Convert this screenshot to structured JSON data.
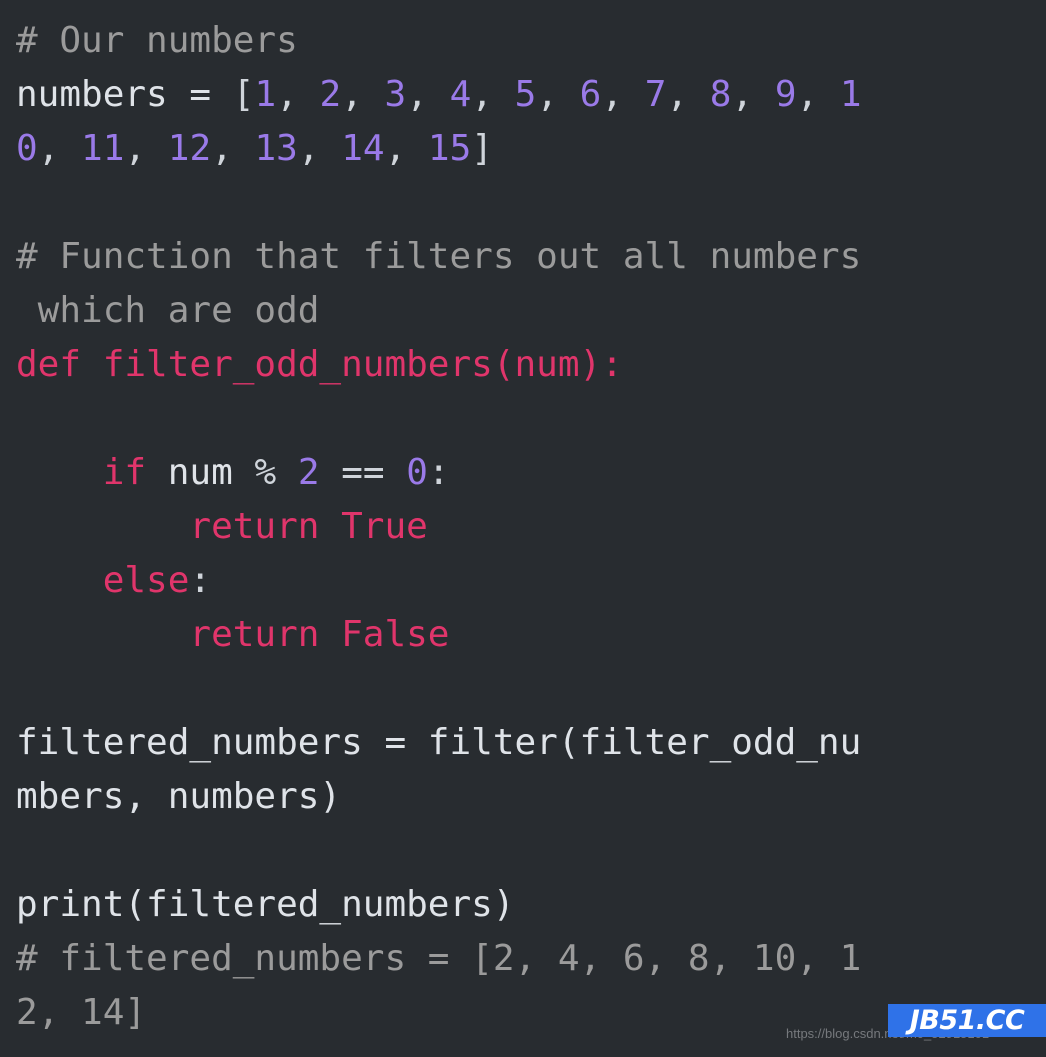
{
  "editor": {
    "language": "python",
    "background_color": "#282c30",
    "theme_colors": {
      "comment": "#9b9b9b",
      "plain": "#dfe3e8",
      "keyword": "#e0356b",
      "number": "#9a7ae8",
      "punct": "#cfd4da",
      "badge_blue": "#2f72e8"
    },
    "full_text": "# Our numbers\nnumbers = [1, 2, 3, 4, 5, 6, 7, 8, 9, 10, 11, 12, 13, 14, 15]\n\n# Function that filters out all numbers which are odd\ndef filter_odd_numbers(num):\n\n    if num % 2 == 0:\n        return True\n    else:\n        return False\n\nfiltered_numbers = filter(filter_odd_numbers, numbers)\n\nprint(filtered_numbers)\n# filtered_numbers = [2, 4, 6, 8, 10, 12, 14]",
    "lines": [
      {
        "id": "line-comment-our-numbers",
        "tokens": [
          {
            "t": "# Our numbers",
            "c": "comment"
          }
        ]
      },
      {
        "id": "line-numbers-assign-part1",
        "tokens": [
          {
            "t": "numbers = ",
            "c": "plain"
          },
          {
            "t": "[",
            "c": "punct"
          },
          {
            "t": "1",
            "c": "number"
          },
          {
            "t": ", ",
            "c": "punct"
          },
          {
            "t": "2",
            "c": "number"
          },
          {
            "t": ", ",
            "c": "punct"
          },
          {
            "t": "3",
            "c": "number"
          },
          {
            "t": ", ",
            "c": "punct"
          },
          {
            "t": "4",
            "c": "number"
          },
          {
            "t": ", ",
            "c": "punct"
          },
          {
            "t": "5",
            "c": "number"
          },
          {
            "t": ", ",
            "c": "punct"
          },
          {
            "t": "6",
            "c": "number"
          },
          {
            "t": ", ",
            "c": "punct"
          },
          {
            "t": "7",
            "c": "number"
          },
          {
            "t": ", ",
            "c": "punct"
          },
          {
            "t": "8",
            "c": "number"
          },
          {
            "t": ", ",
            "c": "punct"
          },
          {
            "t": "9",
            "c": "number"
          },
          {
            "t": ", ",
            "c": "punct"
          },
          {
            "t": "1",
            "c": "number"
          }
        ]
      },
      {
        "id": "line-numbers-assign-part2",
        "tokens": [
          {
            "t": "0",
            "c": "number"
          },
          {
            "t": ", ",
            "c": "punct"
          },
          {
            "t": "11",
            "c": "number"
          },
          {
            "t": ", ",
            "c": "punct"
          },
          {
            "t": "12",
            "c": "number"
          },
          {
            "t": ", ",
            "c": "punct"
          },
          {
            "t": "13",
            "c": "number"
          },
          {
            "t": ", ",
            "c": "punct"
          },
          {
            "t": "14",
            "c": "number"
          },
          {
            "t": ", ",
            "c": "punct"
          },
          {
            "t": "15",
            "c": "number"
          },
          {
            "t": "]",
            "c": "punct"
          }
        ]
      },
      {
        "id": "line-blank-1",
        "tokens": []
      },
      {
        "id": "line-comment-function-part1",
        "tokens": [
          {
            "t": "# Function that filters out all numbers",
            "c": "comment"
          }
        ]
      },
      {
        "id": "line-comment-function-part2",
        "tokens": [
          {
            "t": " which are odd",
            "c": "comment"
          }
        ]
      },
      {
        "id": "line-def-filter-odd-numbers",
        "tokens": [
          {
            "t": "def filter_odd_numbers(num):",
            "c": "func"
          }
        ]
      },
      {
        "id": "line-blank-2",
        "tokens": []
      },
      {
        "id": "line-if-num-mod",
        "tokens": [
          {
            "t": "    ",
            "c": "plain"
          },
          {
            "t": "if",
            "c": "keyword"
          },
          {
            "t": " num ",
            "c": "plain"
          },
          {
            "t": "%",
            "c": "punct"
          },
          {
            "t": " ",
            "c": "plain"
          },
          {
            "t": "2",
            "c": "number"
          },
          {
            "t": " ",
            "c": "plain"
          },
          {
            "t": "==",
            "c": "punct"
          },
          {
            "t": " ",
            "c": "plain"
          },
          {
            "t": "0",
            "c": "number"
          },
          {
            "t": ":",
            "c": "punct"
          }
        ]
      },
      {
        "id": "line-return-true",
        "tokens": [
          {
            "t": "        ",
            "c": "plain"
          },
          {
            "t": "return True",
            "c": "keyword"
          }
        ]
      },
      {
        "id": "line-else",
        "tokens": [
          {
            "t": "    ",
            "c": "plain"
          },
          {
            "t": "else",
            "c": "keyword"
          },
          {
            "t": ":",
            "c": "punct"
          }
        ]
      },
      {
        "id": "line-return-false",
        "tokens": [
          {
            "t": "        ",
            "c": "plain"
          },
          {
            "t": "return False",
            "c": "keyword"
          }
        ]
      },
      {
        "id": "line-blank-3",
        "tokens": []
      },
      {
        "id": "line-filtered-assign-part1",
        "tokens": [
          {
            "t": "filtered_numbers = filter(filter_odd_nu",
            "c": "plain"
          }
        ]
      },
      {
        "id": "line-filtered-assign-part2",
        "tokens": [
          {
            "t": "mbers, numbers)",
            "c": "plain"
          }
        ]
      },
      {
        "id": "line-blank-4",
        "tokens": []
      },
      {
        "id": "line-print-filtered",
        "tokens": [
          {
            "t": "print(filtered_numbers)",
            "c": "plain"
          }
        ]
      },
      {
        "id": "line-comment-result-part1",
        "tokens": [
          {
            "t": "# filtered_numbers = [2, 4, 6, 8, 10, 1",
            "c": "comment"
          }
        ]
      },
      {
        "id": "line-comment-result-part2",
        "tokens": [
          {
            "t": "2, 14]",
            "c": "comment"
          }
        ]
      }
    ]
  },
  "watermark": {
    "url_text": "https://blog.csdn.net/m0_52915101",
    "badge_text": "JB51.CC"
  }
}
